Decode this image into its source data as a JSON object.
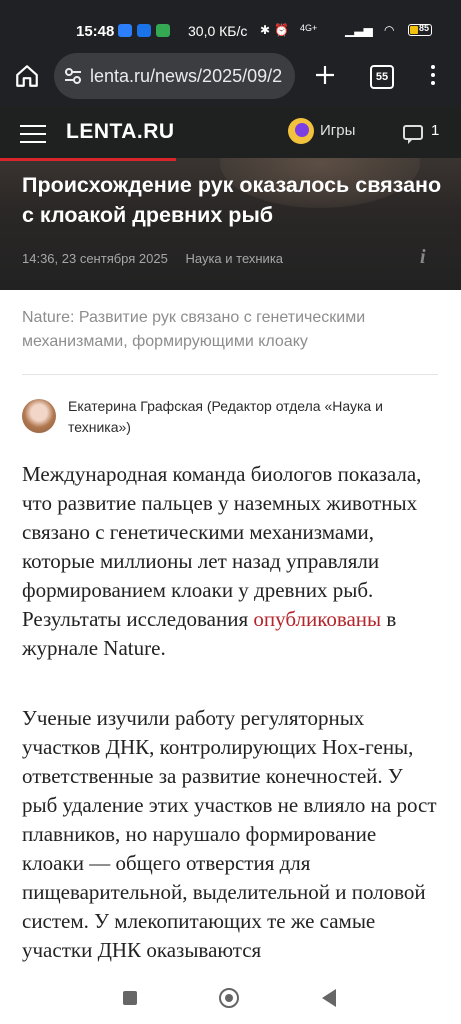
{
  "status_bar": {
    "time": "15:48",
    "speed": "30,0 КБ/с",
    "network": "4G+",
    "battery_level": "85"
  },
  "browser": {
    "url": "lenta.ru/news/2025/09/2",
    "tab_count": "55"
  },
  "site": {
    "logo": "LENTA.RU",
    "games_label": "Игры",
    "comments_count": "1"
  },
  "article": {
    "title": "Происхождение рук оказалось связано с клоакой древних рыб",
    "datetime": "14:36, 23 сентября 2025",
    "rubric": "Наука и техника",
    "lead": "Nature: Развитие рук связано с генетическими механизмами, формирующими клоаку",
    "author": "Екатерина Графская (Редактор отдела «Наука и техника»)",
    "p1_before": "Международная команда биологов показала, что развитие пальцев у наземных животных связано с генетическими механизмами, которые миллионы лет назад управляли формированием клоаки у древних рыб. Результаты исследования ",
    "p1_link": "опубликованы",
    "p1_after": " в журнале Nature.",
    "p2": "Ученые изучили работу регуляторных участков ДНК, контролирующих Hox-гены, ответственные за развитие конечностей. У рыб удаление этих участков не влияло на рост плавников, но нарушало формирование клоаки — общего отверстия для пищеварительной, выделительной и половой систем. У млекопитающих те же самые участки ДНК оказываются"
  },
  "colors": {
    "accent": "#d9262c",
    "link": "#b4242a",
    "header_bg": "#1f2020"
  },
  "icons": {
    "home": "home-icon",
    "tune": "tune-icon",
    "plus": "plus-icon",
    "menu": "more-vert-icon",
    "burger": "hamburger-icon",
    "games": "games-icon",
    "comments": "comment-icon",
    "info": "info-icon"
  }
}
